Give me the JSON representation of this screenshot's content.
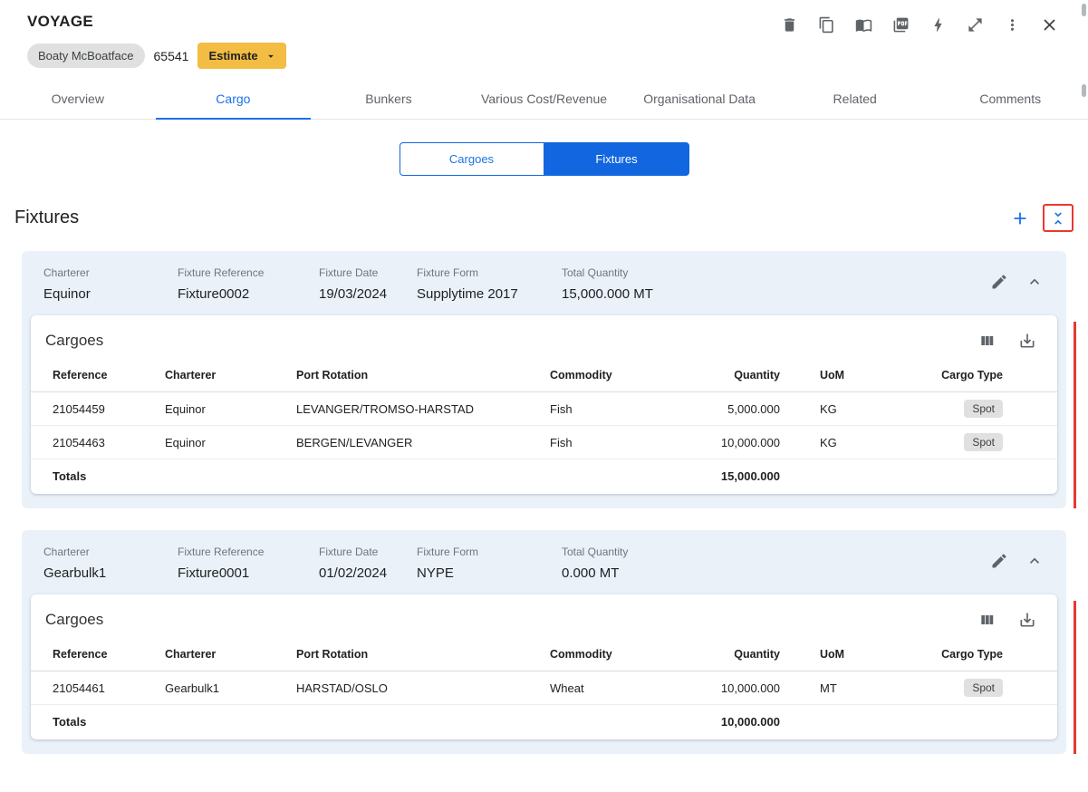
{
  "colors": {
    "accent_blue": "#1a73e8",
    "selected_blue": "#1266e0",
    "estimate_amber": "#f2bd42",
    "card_bg": "#eaf1f9",
    "red_accent": "#e53935",
    "icon_gray": "#5f6368"
  },
  "header": {
    "title": "VOYAGE",
    "vessel_chip": "Boaty McBoatface",
    "voyage_number": "65541",
    "estimate_button": "Estimate",
    "icons": {
      "delete": "trash-can",
      "copy": "duplicate",
      "book": "open-book",
      "pdf": "pdf-export",
      "bolt": "lightning",
      "expand": "open-in-full",
      "more": "kebab-menu",
      "close": "close-x"
    }
  },
  "tabs": [
    {
      "label": "Overview"
    },
    {
      "label": "Cargo"
    },
    {
      "label": "Bunkers"
    },
    {
      "label": "Various Cost/Revenue"
    },
    {
      "label": "Organisational Data"
    },
    {
      "label": "Related"
    },
    {
      "label": "Comments"
    }
  ],
  "toggle": {
    "left": "Cargoes",
    "right": "Fixtures"
  },
  "fixtures_section": {
    "title": "Fixtures"
  },
  "labels": {
    "charterer": "Charterer",
    "fixture_reference": "Fixture Reference",
    "fixture_date": "Fixture Date",
    "fixture_form": "Fixture Form",
    "total_quantity": "Total Quantity",
    "cargoes": "Cargoes",
    "totals": "Totals"
  },
  "columns": [
    "Reference",
    "Charterer",
    "Port Rotation",
    "Commodity",
    "Quantity",
    "UoM",
    "Cargo Type"
  ],
  "fixtures": [
    {
      "charterer": "Equinor",
      "reference": "Fixture0002",
      "date": "19/03/2024",
      "form": "Supplytime 2017",
      "total_quantity": "15,000.000 MT",
      "rows": [
        {
          "reference": "21054459",
          "charterer": "Equinor",
          "port_rotation": "LEVANGER/TROMSO-HARSTAD",
          "commodity": "Fish",
          "quantity": "5,000.000",
          "uom": "KG",
          "cargo_type": "Spot"
        },
        {
          "reference": "21054463",
          "charterer": "Equinor",
          "port_rotation": "BERGEN/LEVANGER",
          "commodity": "Fish",
          "quantity": "10,000.000",
          "uom": "KG",
          "cargo_type": "Spot"
        }
      ],
      "totals_quantity": "15,000.000"
    },
    {
      "charterer": "Gearbulk1",
      "reference": "Fixture0001",
      "date": "01/02/2024",
      "form": "NYPE",
      "total_quantity": "0.000 MT",
      "rows": [
        {
          "reference": "21054461",
          "charterer": "Gearbulk1",
          "port_rotation": "HARSTAD/OSLO",
          "commodity": "Wheat",
          "quantity": "10,000.000",
          "uom": "MT",
          "cargo_type": "Spot"
        }
      ],
      "totals_quantity": "10,000.000"
    }
  ]
}
